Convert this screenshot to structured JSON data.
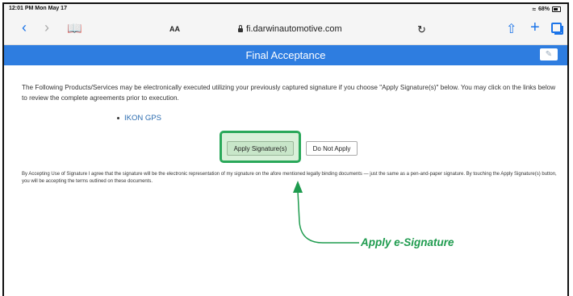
{
  "status_bar": {
    "time": "12:01 PM  Mon May 17",
    "battery": "68%"
  },
  "browser": {
    "reader": "AA",
    "url": "fi.darwinautomotive.com"
  },
  "page": {
    "header": "Final Acceptance",
    "intro": "The Following Products/Services may be electronically executed utilizing your previously captured signature if you choose \"Apply Signature(s)\" below. You may click on the links below to review the complete agreements prior to execution.",
    "products": [
      {
        "label": "IKON GPS"
      }
    ],
    "apply_button": "Apply Signature(s)",
    "no_apply_button": "Do Not Apply",
    "disclaimer": "By Accepting Use of Signature I agree that the signature will be the electronic representation of my signature on the afore mentioned legally binding documents — just the same as a pen-and-paper signature. By touching the Apply Signature(s) button, you will be accepting the terms outlined on these documents."
  },
  "callout": {
    "label": "Apply e-Signature",
    "color": "#1e9b4e"
  },
  "colors": {
    "header": "#2e7de0",
    "link": "#2b6cb0",
    "highlight": "#2aa85a"
  }
}
